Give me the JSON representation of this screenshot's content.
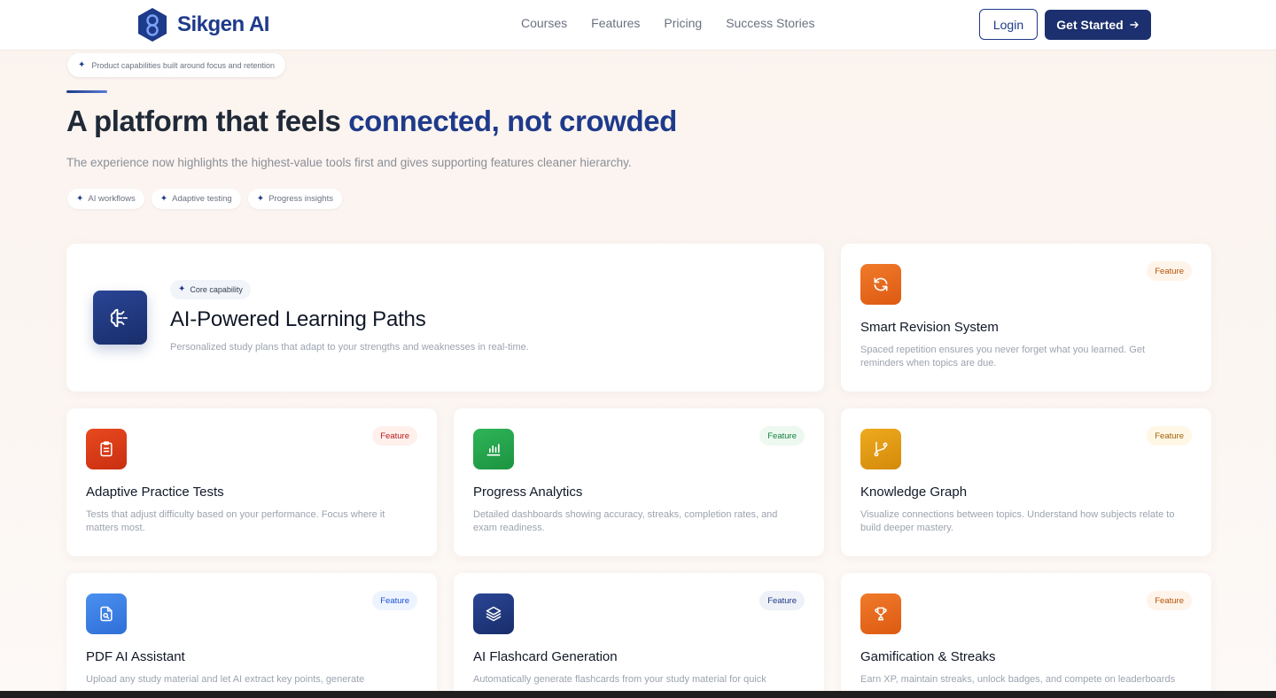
{
  "brand": {
    "name": "Sikgen AI"
  },
  "nav": {
    "items": [
      "Courses",
      "Features",
      "Pricing",
      "Success Stories"
    ]
  },
  "header": {
    "login_label": "Login",
    "get_started_label": "Get Started"
  },
  "hero": {
    "eyebrow": "Product capabilities built around focus and retention",
    "title_main": "A platform that feels ",
    "title_highlight": "connected, not crowded",
    "subtitle": "The experience now highlights the highest-value tools first and gives supporting features cleaner hierarchy.",
    "tags": [
      "AI workflows",
      "Adaptive testing",
      "Progress insights"
    ]
  },
  "featured": {
    "pill": "Core capability",
    "title": "AI-Powered Learning Paths",
    "description": "Personalized study plans that adapt to your strengths and weaknesses in real-time.",
    "icon": "brain-icon"
  },
  "features": [
    {
      "title": "Smart Revision System",
      "description": "Spaced repetition ensures you never forget what you learned. Get reminders when topics are due.",
      "badge": "Feature",
      "icon": "refresh-icon",
      "color": "#ea6a1f",
      "badge_color": "#b45309",
      "badge_bg": "#fff4ea"
    },
    {
      "title": "Adaptive Practice Tests",
      "description": "Tests that adjust difficulty based on your performance. Focus where it matters most.",
      "badge": "Feature",
      "icon": "clipboard-icon",
      "color": "#dc3b17",
      "badge_color": "#b91c1c",
      "badge_bg": "#fff0ec"
    },
    {
      "title": "Progress Analytics",
      "description": "Detailed dashboards showing accuracy, streaks, completion rates, and exam readiness.",
      "badge": "Feature",
      "icon": "bar-chart-icon",
      "color": "#22a34a",
      "badge_color": "#15803d",
      "badge_bg": "#edf9f0"
    },
    {
      "title": "Knowledge Graph",
      "description": "Visualize connections between topics. Understand how subjects relate to build deeper mastery.",
      "badge": "Feature",
      "icon": "git-branch-icon",
      "color": "#e39a12",
      "badge_color": "#a16207",
      "badge_bg": "#fff7e6"
    },
    {
      "title": "PDF AI Assistant",
      "description": "Upload any study material and let AI extract key points, generate",
      "badge": "Feature",
      "icon": "file-search-icon",
      "color": "#3b82f6",
      "badge_color": "#1d4ed8",
      "badge_bg": "#eef4ff"
    },
    {
      "title": "AI Flashcard Generation",
      "description": "Automatically generate flashcards from your study material for quick",
      "badge": "Feature",
      "icon": "layers-icon",
      "color": "#1e3a8a",
      "badge_color": "#1e3a8a",
      "badge_bg": "#eef1f7"
    },
    {
      "title": "Gamification & Streaks",
      "description": "Earn XP, maintain streaks, unlock badges, and compete on leaderboards",
      "badge": "Feature",
      "icon": "trophy-icon",
      "color": "#ea6a1f",
      "badge_color": "#b45309",
      "badge_bg": "#fff4ea"
    }
  ]
}
